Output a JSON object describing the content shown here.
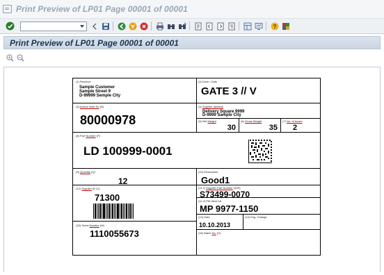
{
  "window": {
    "title": "Print Preview of LP01 Page 00001 of 00001"
  },
  "toolbar": {
    "command_field_value": ""
  },
  "panel": {
    "title": "Print Preview of LP01 Page 00001 of 00001"
  },
  "label": {
    "receiver": {
      "caption": "(1) Receiver",
      "lines": [
        "Sample Customer",
        "Sample Street 9",
        "D-99999 Semple City"
      ]
    },
    "dock_gate": {
      "caption": "(2) Dock / Gate",
      "value": "GATE 3 // V"
    },
    "advice_note": {
      "caption_prefix": "(3) ",
      "caption_link": "Advice Note No",
      "caption_suffix": " (N)",
      "value": "80000978"
    },
    "supplier_address": {
      "caption_prefix": "(4) ",
      "caption_link": "Supplier address",
      "lines": [
        "Delivery Square 9999",
        "D-9999 Sample City"
      ]
    },
    "net_weight": {
      "caption_prefix": "(5) Net ",
      "caption_link": "Weight",
      "value": "30"
    },
    "gross_weight": {
      "caption_prefix": "(6) ",
      "caption_link": "Gross Weight",
      "value": "35"
    },
    "no_of_boxes": {
      "caption_prefix": "(7) ",
      "caption_link": "No. of boxes",
      "value": "2"
    },
    "part_number": {
      "caption_prefix": "(8) Part ",
      "caption_link": "Number",
      "caption_suffix": " (P)",
      "value": "LD 100999-0001"
    },
    "quantity": {
      "caption_prefix": "(9) ",
      "caption_link": "Quantity",
      "caption_suffix": " (Q)",
      "value": "12"
    },
    "description": {
      "caption": "(10) Description",
      "value": "Good1"
    },
    "supplier_part_number": {
      "caption_prefix": "(11.1) ",
      "caption_link": "Supplier Part Number",
      "caption_suffix": " (30S)",
      "value": "S73499-0070"
    },
    "pm_ident_nr": {
      "caption": "(11.2) PM-Ident-Nr.",
      "value": "MP 9977-1150"
    },
    "supplier_id": {
      "caption_prefix": "(12) ",
      "caption_link": "Supplier",
      "caption_suffix": " ID (V)",
      "value": "71300"
    },
    "date": {
      "caption": "(13) Date",
      "value": "10.10.2013"
    },
    "eng_change": {
      "caption": "(14) Eng. Change",
      "value": ""
    },
    "serial_number": {
      "caption_prefix": "(15) Serial ",
      "caption_link": "Number",
      "caption_suffix": " (M)",
      "value": "1110055673"
    },
    "batch_no": {
      "caption_prefix": "(16) Batch ",
      "caption_link": "No.",
      "caption_suffix": " (H)",
      "value": ""
    }
  },
  "icons": [
    "enter-icon",
    "back-icon",
    "save-icon",
    "back-nav-icon",
    "exit-icon",
    "cancel-icon",
    "print-icon",
    "find-icon",
    "find-next-icon",
    "first-page-icon",
    "prev-page-icon",
    "next-page-icon",
    "last-page-icon",
    "layout-icon",
    "monitor-icon",
    "help-icon",
    "customize-icon",
    "zoom-in-icon",
    "zoom-out-icon"
  ]
}
